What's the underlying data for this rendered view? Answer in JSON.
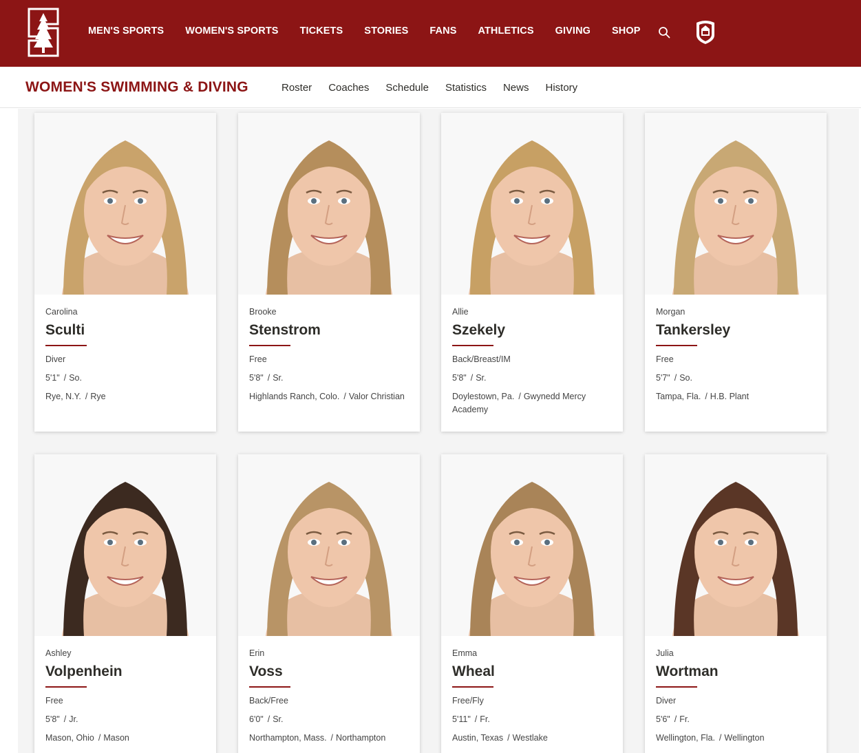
{
  "header": {
    "nav": [
      "MEN'S SPORTS",
      "WOMEN'S SPORTS",
      "TICKETS",
      "STORIES",
      "FANS",
      "ATHLETICS",
      "GIVING",
      "SHOP"
    ]
  },
  "subheader": {
    "title": "WOMEN'S SWIMMING & DIVING",
    "links": [
      "Roster",
      "Coaches",
      "Schedule",
      "Statistics",
      "News",
      "History"
    ]
  },
  "colors": {
    "brand": "#8c1515",
    "background": "#f4f4f4"
  },
  "icons": [
    "stanford-tree-logo-icon",
    "search-icon",
    "pac12-logo-icon"
  ],
  "roster": [
    {
      "first": "Carolina",
      "last": "Sculti",
      "position": "Diver",
      "height": "5'1\"",
      "year": "So.",
      "hometown": "Rye, N.Y.",
      "school": "Rye",
      "hair": "#c9a36b"
    },
    {
      "first": "Brooke",
      "last": "Stenstrom",
      "position": "Free",
      "height": "5'8\"",
      "year": "Sr.",
      "hometown": "Highlands Ranch, Colo.",
      "school": "Valor Christian",
      "hair": "#b58e5c"
    },
    {
      "first": "Allie",
      "last": "Szekely",
      "position": "Back/Breast/IM",
      "height": "5'8\"",
      "year": "Sr.",
      "hometown": "Doylestown, Pa.",
      "school": "Gwynedd Mercy Academy",
      "hair": "#c7a064"
    },
    {
      "first": "Morgan",
      "last": "Tankersley",
      "position": "Free",
      "height": "5'7\"",
      "year": "So.",
      "hometown": "Tampa, Fla.",
      "school": "H.B. Plant",
      "hair": "#c8a874"
    },
    {
      "first": "Ashley",
      "last": "Volpenhein",
      "position": "Free",
      "height": "5'8\"",
      "year": "Jr.",
      "hometown": "Mason, Ohio",
      "school": "Mason",
      "hair": "#3c2a20"
    },
    {
      "first": "Erin",
      "last": "Voss",
      "position": "Back/Free",
      "height": "6'0\"",
      "year": "Sr.",
      "hometown": "Northampton, Mass.",
      "school": "Northampton",
      "hair": "#b89466"
    },
    {
      "first": "Emma",
      "last": "Wheal",
      "position": "Free/Fly",
      "height": "5'11\"",
      "year": "Fr.",
      "hometown": "Austin, Texas",
      "school": "Westlake",
      "hair": "#a98458"
    },
    {
      "first": "Julia",
      "last": "Wortman",
      "position": "Diver",
      "height": "5'6\"",
      "year": "Fr.",
      "hometown": "Wellington, Fla.",
      "school": "Wellington",
      "hair": "#5a3626"
    }
  ]
}
